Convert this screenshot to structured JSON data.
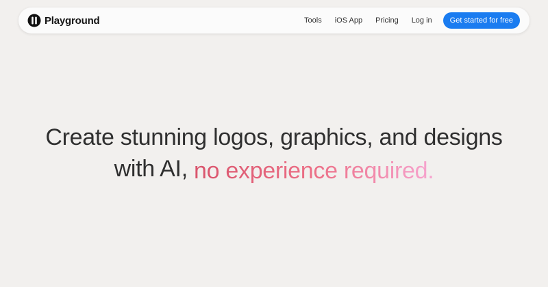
{
  "brand": {
    "name": "Playground",
    "logo_icon": "playground-logo-icon"
  },
  "nav": {
    "links": [
      {
        "label": "Tools"
      },
      {
        "label": "iOS App"
      },
      {
        "label": "Pricing"
      },
      {
        "label": "Log in"
      }
    ],
    "cta_label": "Get started for free"
  },
  "hero": {
    "line1": "Create stunning logos, graphics, and designs",
    "line2_prefix": "with AI,",
    "line2_accent": "no experience required."
  },
  "colors": {
    "background": "#f2f0ee",
    "cta": "#1a7cf0",
    "accent_start": "#d9546c",
    "accent_end": "#f7a5d0"
  }
}
